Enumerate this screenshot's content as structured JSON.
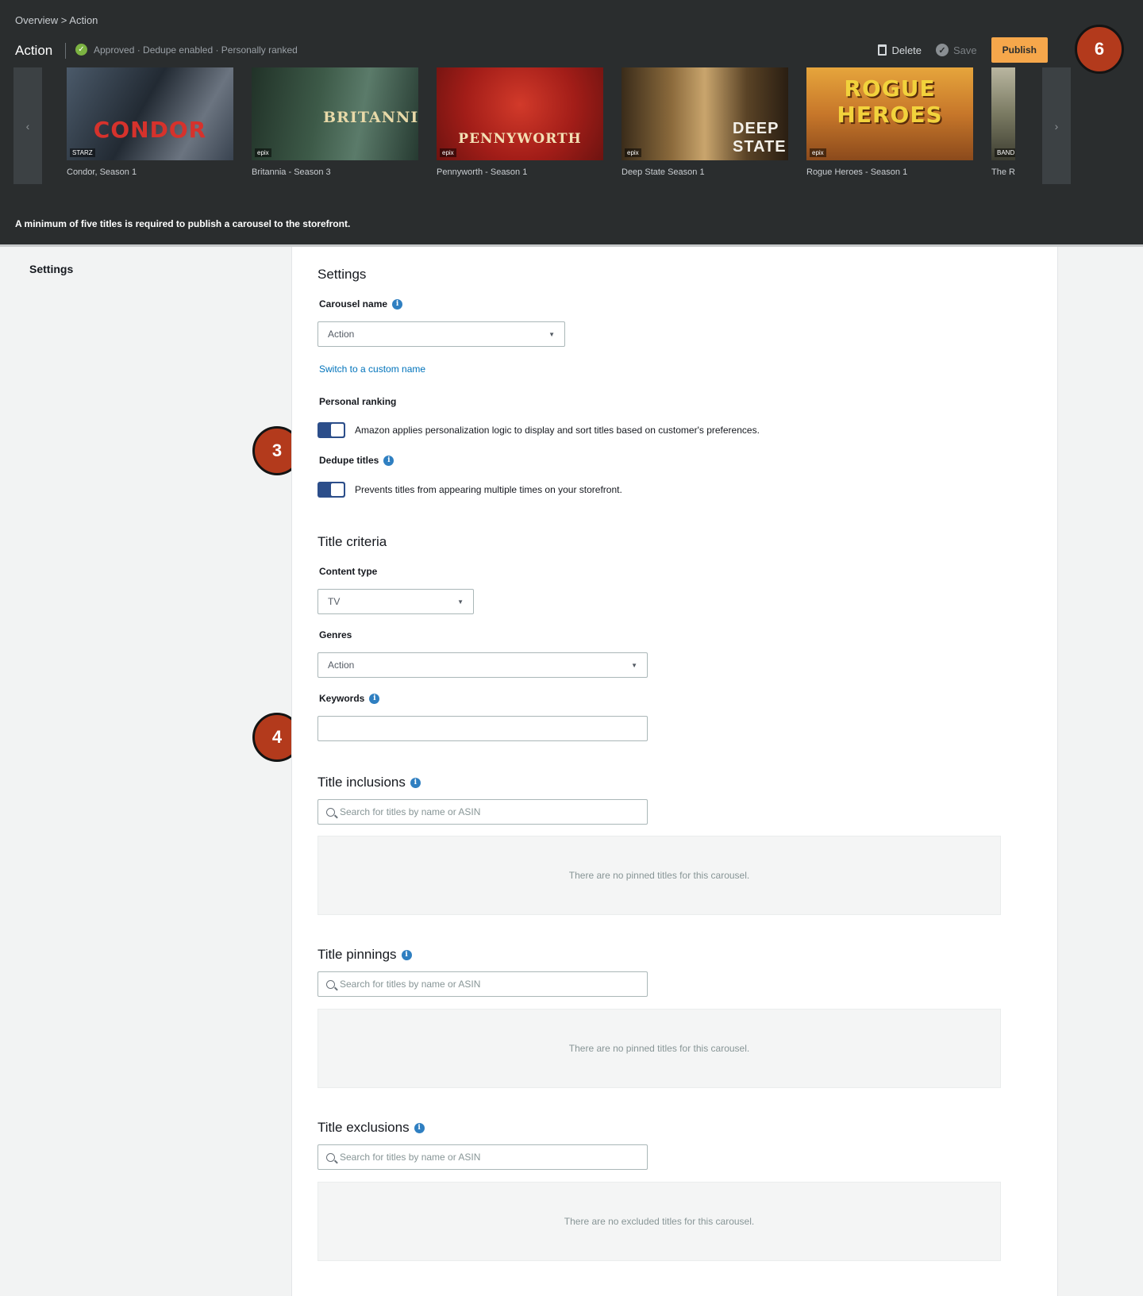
{
  "header": {
    "breadcrumb": "Overview > Action",
    "title": "Action",
    "status_icon": "check-circle-icon",
    "status_text": "Approved · Dedupe enabled · Personally ranked",
    "delete_label": "Delete",
    "save_label": "Save",
    "publish_label": "Publish",
    "accent_color": "#f6a74b"
  },
  "carousel": {
    "prev_icon": "‹",
    "next_icon": "›",
    "tiles": [
      {
        "label": "Condor, Season 1",
        "poster_text": "CONDOR",
        "badge": "STARZ"
      },
      {
        "label": "Britannia - Season 3",
        "poster_text": "BRITANNIA",
        "badge": "epix"
      },
      {
        "label": "Pennyworth - Season 1",
        "poster_text": "PENNYWORTH",
        "badge": "epix"
      },
      {
        "label": "Deep State Season 1",
        "poster_text": "DEEP STATE",
        "badge": "epix"
      },
      {
        "label": "Rogue Heroes - Season 1",
        "poster_text": "ROGUE HEROES",
        "badge": "epix"
      },
      {
        "label": "The R",
        "poster_text": "",
        "badge": "BAND"
      }
    ],
    "notice": "A minimum of five titles is required to publish a carousel to the storefront."
  },
  "markers": {
    "m6": "6",
    "m3": "3",
    "m4": "4"
  },
  "sidebar": {
    "label": "Settings"
  },
  "settings": {
    "heading": "Settings",
    "carousel_name_label": "Carousel name",
    "carousel_name_value": "Action",
    "custom_name_link": "Switch to a custom name",
    "personal_ranking_label": "Personal ranking",
    "personal_ranking_text": "Amazon applies personalization logic to display and sort titles based on customer's preferences.",
    "dedupe_label": "Dedupe titles",
    "dedupe_text": "Prevents titles from appearing multiple times on your storefront."
  },
  "criteria": {
    "heading": "Title criteria",
    "content_type_label": "Content type",
    "content_type_value": "TV",
    "genres_label": "Genres",
    "genres_value": "Action",
    "keywords_label": "Keywords",
    "keywords_value": ""
  },
  "inclusions": {
    "heading": "Title inclusions",
    "placeholder": "Search for titles by name or ASIN",
    "empty": "There are no pinned titles for this carousel."
  },
  "pinnings": {
    "heading": "Title pinnings",
    "placeholder": "Search for titles by name or ASIN",
    "empty": "There are no pinned titles for this carousel."
  },
  "exclusions": {
    "heading": "Title exclusions",
    "placeholder": "Search for titles by name or ASIN",
    "empty": "There are no excluded titles for this carousel."
  }
}
